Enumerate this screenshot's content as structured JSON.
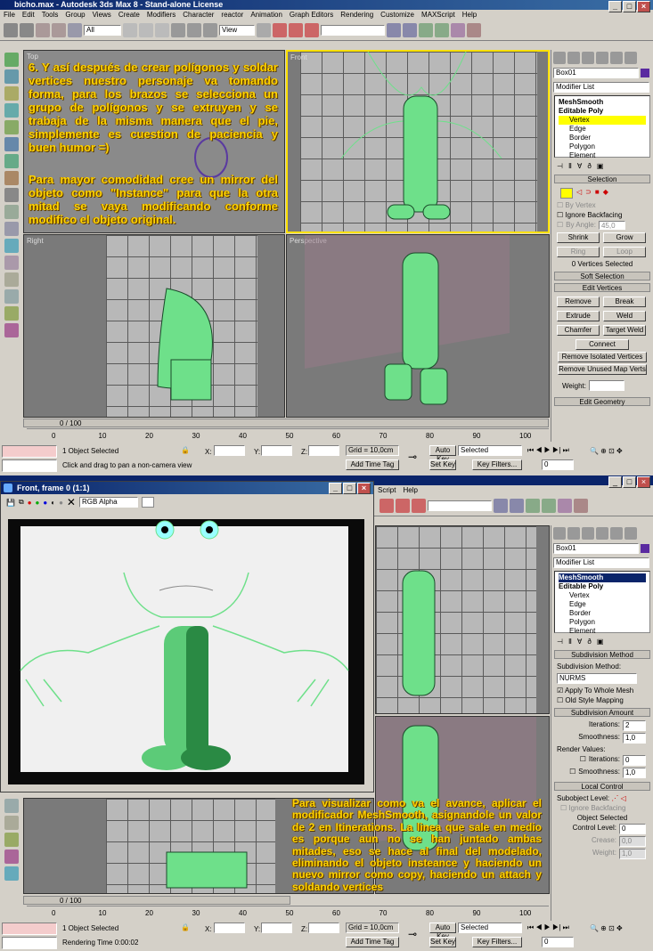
{
  "top": {
    "title": "bicho.max - Autodesk 3ds Max 8 - Stand-alone License",
    "menu": [
      "File",
      "Edit",
      "Tools",
      "Group",
      "Views",
      "Create",
      "Modifiers",
      "Character",
      "reactor",
      "Animation",
      "Graph Editors",
      "Rendering",
      "Customize",
      "MAXScript",
      "Help"
    ],
    "selection_filter": "All",
    "ref_coord": "View",
    "viewports": {
      "top": "Top",
      "front": "Front",
      "right": "Right",
      "perspective": "Perspective"
    },
    "text1": "6. Y así después de crear polígonos y soldar vertices nuestro personaje va tomando forma, para los brazos se selecciona un grupo de polígonos y se extruyen y se trabaja de la misma manera que el pie, simplemente es cuestion de paciencia y buen humor =)",
    "text2": "Para mayor comodidad cree un mirror del objeto como \"Instance\" para que la otra mitad se vaya modificando conforme modifico el objeto original.",
    "object_name": "Box01",
    "modifier_list": "Modifier List",
    "stack": [
      "MeshSmooth",
      "Editable Poly",
      "Vertex",
      "Edge",
      "Border",
      "Polygon",
      "Element"
    ],
    "selection": {
      "title": "Selection",
      "by_vertex": "By Vertex",
      "ignore_backfacing": "Ignore Backfacing",
      "by_angle": "By Angle:",
      "angle_val": "45,0",
      "shrink": "Shrink",
      "grow": "Grow",
      "ring": "Ring",
      "loop": "Loop",
      "selected": "0 Vertices Selected"
    },
    "soft_selection": "Soft Selection",
    "edit_vertices": {
      "title": "Edit Vertices",
      "remove": "Remove",
      "break": "Break",
      "extrude": "Extrude",
      "weld": "Weld",
      "chamfer": "Chamfer",
      "target_weld": "Target Weld",
      "connect": "Connect",
      "remove_isolated": "Remove Isolated Vertices",
      "remove_unused": "Remove Unused Map Verts",
      "weight": "Weight:"
    },
    "edit_geometry": "Edit Geometry",
    "timeline": "0 / 100",
    "ticks": [
      "0",
      "10",
      "20",
      "30",
      "40",
      "50",
      "60",
      "70",
      "80",
      "90",
      "100"
    ],
    "status_selected": "1 Object Selected",
    "prompt": "Click and drag to pan a non-camera view",
    "x_label": "X:",
    "y_label": "Y:",
    "z_label": "Z:",
    "grid": "Grid = 10,0cm",
    "add_time_tag": "Add Time Tag",
    "auto_key": "Auto Key",
    "set_key": "Set Key",
    "key_selected": "Selected",
    "key_filters": "Key Filters...",
    "frame": "0"
  },
  "bottom": {
    "menu": [
      "Script",
      "Help"
    ],
    "render_title": "Front, frame 0 (1:1)",
    "channel": "RGB Alpha",
    "object_name": "Box01",
    "modifier_list": "Modifier List",
    "stack": [
      "MeshSmooth",
      "Editable Poly",
      "Vertex",
      "Edge",
      "Border",
      "Polygon",
      "Element"
    ],
    "subdivision_method": {
      "title": "Subdivision Method",
      "label": "Subdivision Method:",
      "value": "NURMS",
      "apply_whole": "Apply To Whole Mesh",
      "old_style": "Old Style Mapping"
    },
    "subdivision_amount": {
      "title": "Subdivision Amount",
      "iterations": "Iterations:",
      "iter_val": "2",
      "smoothness": "Smoothness:",
      "smooth_val": "1,0",
      "render_values": "Render Values:",
      "r_iterations": "Iterations:",
      "r_iter_val": "0",
      "r_smoothness": "Smoothness:",
      "r_smooth_val": "1,0"
    },
    "local_control": {
      "title": "Local Control",
      "sub_level": "Subobject Level:",
      "ignore_backfacing": "Ignore Backfacing",
      "object_selected": "Object Selected",
      "control_level": "Control Level:",
      "control_val": "0",
      "crease": "Crease:",
      "crease_val": "0,0",
      "weight": "Weight:",
      "weight_val": "1,0"
    },
    "text": "Para visualizar como va el avance, aplicar el modificador MeshSmooth, asignandole un valor de 2 en Itinerations. La linea que sale en medio es porque aun no se han juntado ambas mitades, eso se hace al final del modelado, eliminando el objeto insteance y haciendo un nuevo mirror como copy, haciendo un attach y soldando vertices",
    "timeline": "0 / 100",
    "ticks": [
      "0",
      "10",
      "20",
      "30",
      "40",
      "50",
      "60",
      "70",
      "80",
      "90",
      "100"
    ],
    "status_selected": "1 Object Selected",
    "render_time": "Rendering Time  0:00:02",
    "grid": "Grid = 10,0cm",
    "add_time_tag": "Add Time Tag",
    "auto_key": "Auto Key",
    "set_key": "Set Key",
    "key_selected": "Selected",
    "key_filters": "Key Filters...",
    "frame": "0"
  },
  "colors": {
    "overlay_text": "#ffd400",
    "mesh_green": "#6ee08a",
    "vertex_highlight": "#ffff00",
    "titlebar": "#0a246a"
  }
}
